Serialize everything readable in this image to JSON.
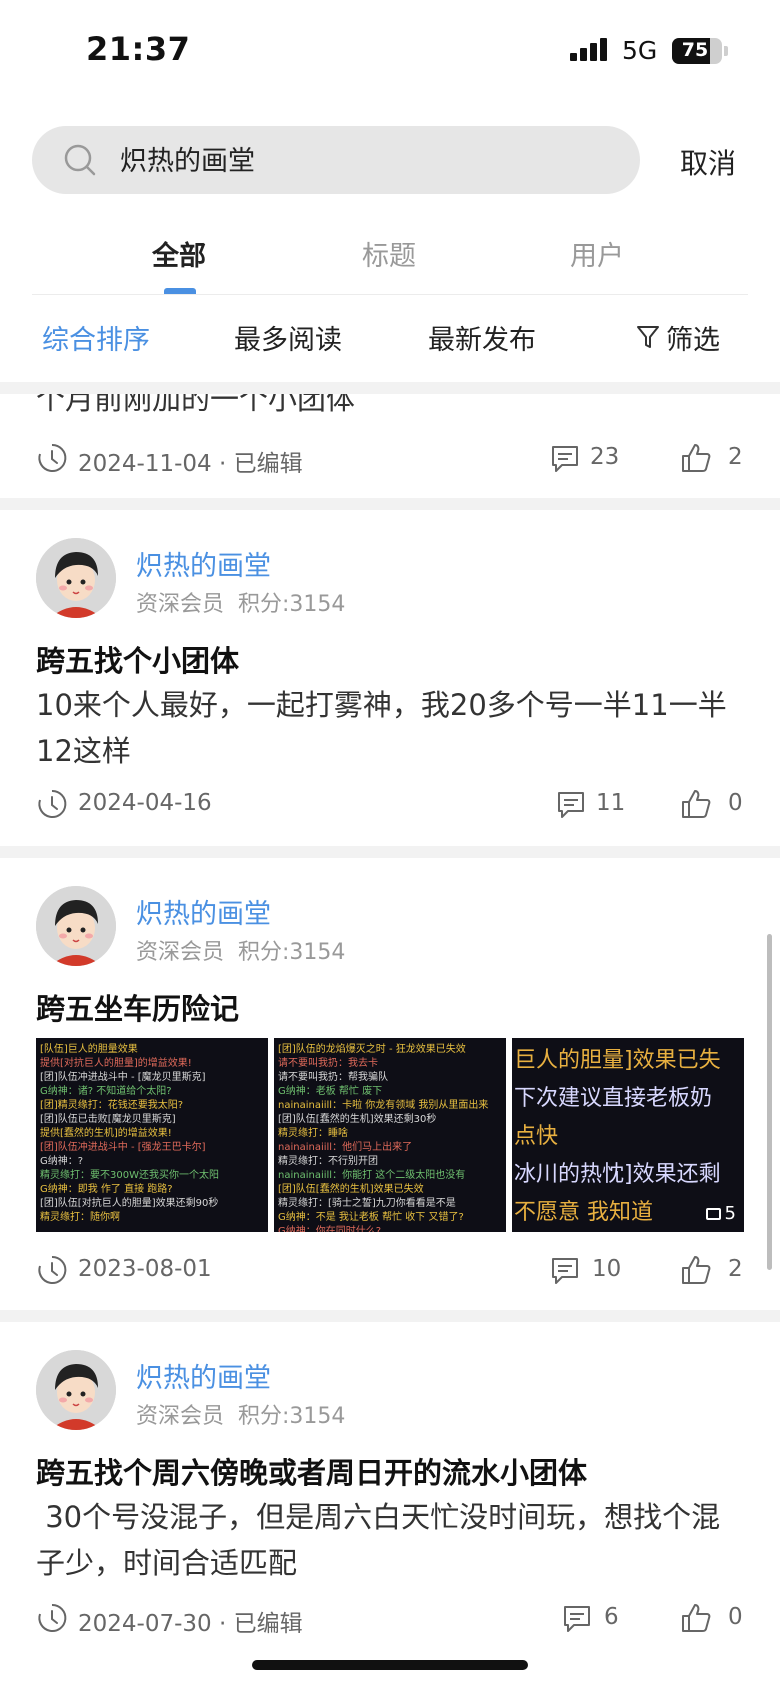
{
  "status_bar": {
    "time": "21:37",
    "network": "5G",
    "battery": "75",
    "battery_level": 0.75
  },
  "search": {
    "value": "炽热的画堂",
    "cancel_label": "取消"
  },
  "tabs": [
    {
      "label": "全部",
      "active": true
    },
    {
      "label": "标题",
      "active": false
    },
    {
      "label": "用户",
      "active": false
    }
  ],
  "sort": {
    "items": [
      {
        "label": "综合排序",
        "active": true
      },
      {
        "label": "最多阅读",
        "active": false
      },
      {
        "label": "最新发布",
        "active": false
      }
    ],
    "filter_label": "筛选"
  },
  "colors": {
    "accent": "#4a90e2",
    "meta_text": "#999999",
    "band": "#f2f2f2"
  },
  "posts": [
    {
      "body_partial": "个月前刚加的一个小团体",
      "date": "2024-11-04",
      "edited": "· 已编辑",
      "comments": "23",
      "likes": "2"
    },
    {
      "author": "炽热的画堂",
      "level": "资深会员",
      "score": "积分:3154",
      "title": "跨五找个小团体",
      "body": "10来个人最好，一起打雾神，我20多个号一半11一半12这样",
      "date": "2024-04-16",
      "comments": "11",
      "likes": "0"
    },
    {
      "author": "炽热的画堂",
      "level": "资深会员",
      "score": "积分:3154",
      "title": "跨五坐车历险记",
      "image_count": "5",
      "date": "2023-08-01",
      "comments": "10",
      "likes": "2"
    },
    {
      "author": "炽热的画堂",
      "level": "资深会员",
      "score": "积分:3154",
      "title": "跨五找个周六傍晚或者周日开的流水小团体",
      "body": " 30个号没混子，但是周六白天忙没时间玩，想找个混子少，时间合适匹配",
      "date": "2024-07-30",
      "edited": "· 已编辑",
      "comments": "6",
      "likes": "0"
    }
  ],
  "thumbnails": {
    "img1": [
      "[队伍]巨人的胆量效果",
      "提供[对抗巨人的胆量]的增益效果!",
      "[团]队伍冲进战斗中 - [魔龙贝里斯克]",
      "G纳神：诸? 不知道给个太阳?",
      "[团]精灵缘打：花钱还要我太阳?",
      "[团]队伍已击败[魔龙贝里斯克]",
      "提供[蠢然的生机]的增益效果!",
      "[团]队伍冲进战斗中 - [强龙王巴卡尔]",
      "G纳神：?",
      "精灵缘打：要不300W还我买你一个太阳",
      "G纳神：即我 作了 直接 跑路?",
      "[团]队伍[对抗巨人的胆量]效果还剩90秒",
      "精灵缘打：随你啊"
    ],
    "img2": [
      "[团]队伍的龙焰爆灭之时 - 狂龙效果已失效",
      "请不要叫我扔：我去卡",
      "请不要叫我扔：帮我骗队",
      "G纳神：老板 帮忙 废下",
      "nainainaiill：卡啦 你龙有领域 我别从里面出来",
      "[团]队伍[蠢然的生机]效果还剩30秒",
      "精灵缘打：睡啥",
      "nainainaiill：他们马上出来了",
      "精灵缘打：不行别开团",
      "nainainaiill：你能打 这个二级太阳也没有",
      "[团]队伍[蠢然的生机]效果已失效",
      "精灵缘打：[骑士之誓]九刀你看看是不是",
      "G纳神：不是 我让老板 帮忙 收下 又错了?",
      "G纳神：你在同时什么?"
    ],
    "img3": [
      "巨人的胆量]效果已失",
      "下次建议直接老板奶",
      "点快",
      "冰川的热忱]效果还剩",
      "不愿意  我知道"
    ]
  }
}
